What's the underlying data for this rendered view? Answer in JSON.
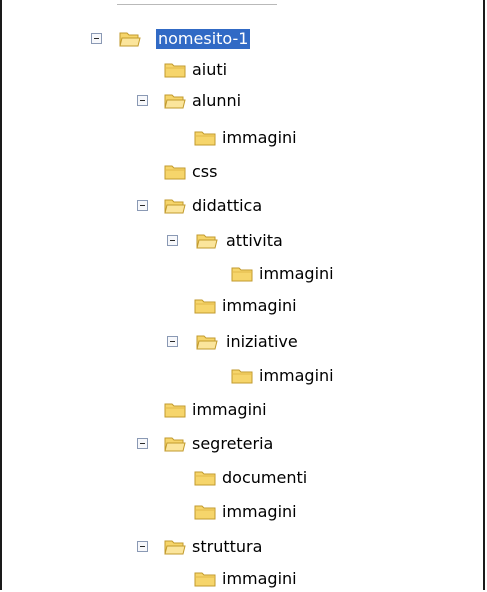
{
  "tree": {
    "items": [
      {
        "label": "nomesito-1",
        "selected": true,
        "expanded": true
      },
      {
        "label": "aiuti"
      },
      {
        "label": "alunni",
        "expanded": true
      },
      {
        "label": "immagini"
      },
      {
        "label": "css"
      },
      {
        "label": "didattica",
        "expanded": true
      },
      {
        "label": "attivita",
        "expanded": true
      },
      {
        "label": "immagini"
      },
      {
        "label": "immagini"
      },
      {
        "label": "iniziative",
        "expanded": true
      },
      {
        "label": "immagini"
      },
      {
        "label": "immagini"
      },
      {
        "label": "segreteria",
        "expanded": true
      },
      {
        "label": "documenti"
      },
      {
        "label": "immagini"
      },
      {
        "label": "struttura",
        "expanded": true
      },
      {
        "label": "immagini"
      }
    ]
  },
  "colors": {
    "selection": "#316ac5",
    "folder_fill": "#f6d56b",
    "folder_edge": "#c29a2c"
  },
  "icons": {
    "folder": "folder-icon",
    "collapse": "minus-box-icon"
  }
}
